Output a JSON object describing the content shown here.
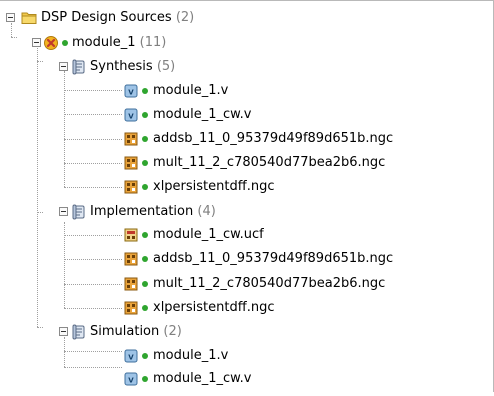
{
  "tree": {
    "root": {
      "label": "DSP Design Sources",
      "count": "(2)",
      "icon": "folder-icon"
    },
    "module": {
      "label": "module_1",
      "count": "(11)",
      "icon": "module-icon"
    },
    "synthesis": {
      "label": "Synthesis",
      "count": "(5)",
      "icon": "scroll-icon",
      "files": [
        {
          "name": "module_1.v",
          "icon": "verilog-file-icon"
        },
        {
          "name": "module_1_cw.v",
          "icon": "verilog-file-icon"
        },
        {
          "name": "addsb_11_0_95379d49f89d651b.ngc",
          "icon": "netlist-file-icon"
        },
        {
          "name": "mult_11_2_c780540d77bea2b6.ngc",
          "icon": "netlist-file-icon"
        },
        {
          "name": "xlpersistentdff.ngc",
          "icon": "netlist-file-icon"
        }
      ]
    },
    "implementation": {
      "label": "Implementation",
      "count": "(4)",
      "icon": "scroll-icon",
      "files": [
        {
          "name": "module_1_cw.ucf",
          "icon": "constraints-file-icon"
        },
        {
          "name": "addsb_11_0_95379d49f89d651b.ngc",
          "icon": "netlist-file-icon"
        },
        {
          "name": "mult_11_2_c780540d77bea2b6.ngc",
          "icon": "netlist-file-icon"
        },
        {
          "name": "xlpersistentdff.ngc",
          "icon": "netlist-file-icon"
        }
      ]
    },
    "simulation": {
      "label": "Simulation",
      "count": "(2)",
      "icon": "scroll-icon",
      "files": [
        {
          "name": "module_1.v",
          "icon": "verilog-file-icon"
        },
        {
          "name": "module_1_cw.v",
          "icon": "verilog-file-icon"
        }
      ]
    }
  },
  "colors": {
    "status_dot": "#2fa52f",
    "count_text": "#808080",
    "tree_lines": "#a0a0a0",
    "folder": "#f2c94c"
  }
}
